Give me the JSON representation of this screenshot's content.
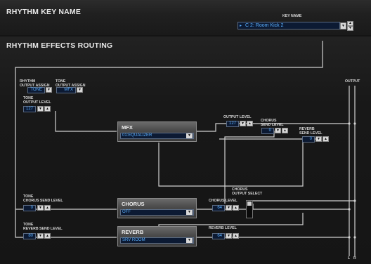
{
  "sections": {
    "key_name_header": "RHYTHM KEY NAME",
    "effects_header": "RHYTHM EFFECTS ROUTING"
  },
  "key_name": {
    "label": "KEY NAME",
    "value": "C 2:  Room Kick 2"
  },
  "rhythm_output_assign": {
    "label": "RHYTHM\nOUTPUT ASSIGN",
    "value": "TONE"
  },
  "tone_output_assign": {
    "label": "TONE\nOUTPUT ASSIGN",
    "value": "MFX"
  },
  "tone_output_level": {
    "label": "TONE\nOUTPUT LEVEL",
    "value": "127"
  },
  "mfx": {
    "title": "MFX",
    "type": "01:EQUALIZER"
  },
  "output_level": {
    "label": "OUTPUT LEVEL",
    "value": "127"
  },
  "chorus_send_level": {
    "label": "CHORUS\nSEND LEVEL",
    "value": "0"
  },
  "reverb_send_level": {
    "label": "REVERB\nSEND LEVEL",
    "value": "0"
  },
  "tone_chorus_send_level": {
    "label": "TONE\nCHORUS SEND LEVEL",
    "value": "0"
  },
  "tone_reverb_send_level": {
    "label": "TONE\nREVERB SEND LEVEL",
    "value": "80"
  },
  "chorus": {
    "title": "CHORUS",
    "type": "OFF"
  },
  "chorus_level": {
    "label": "CHORUS LEVEL",
    "value": "64"
  },
  "chorus_output_select": {
    "label": "CHORUS\nOUTPUT SELECT"
  },
  "reverb": {
    "title": "REVERB",
    "type": "SRV ROOM"
  },
  "reverb_level": {
    "label": "REVERB LEVEL",
    "value": "64"
  },
  "output": {
    "label": "OUTPUT",
    "left": "L",
    "right": "R"
  },
  "controls": {
    "down": "▼",
    "up": "▲",
    "dropdown": "▼"
  }
}
